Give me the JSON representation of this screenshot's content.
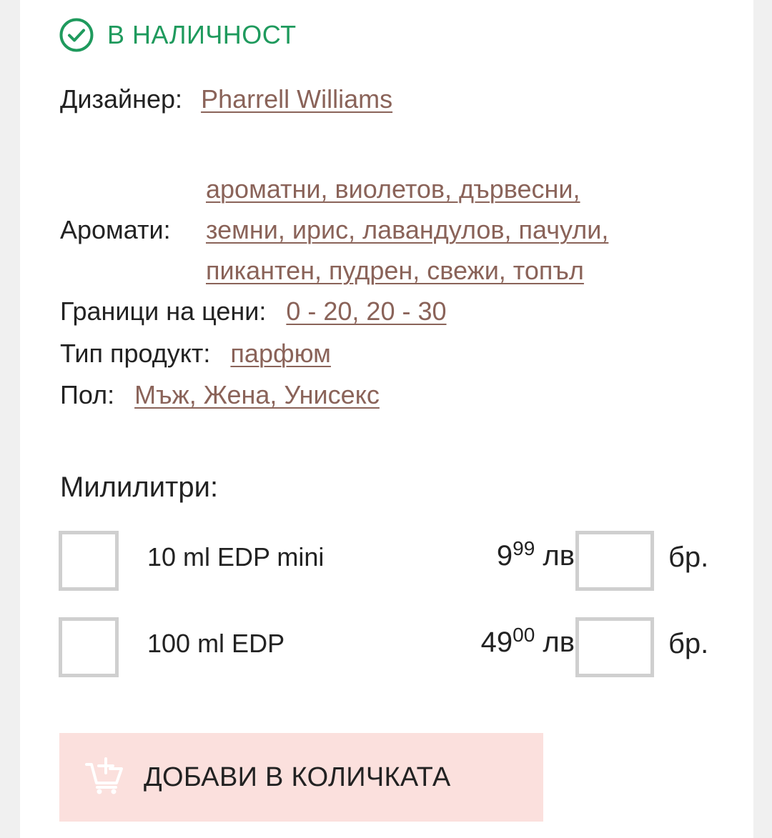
{
  "stock": {
    "status": "В НАЛИЧНОСТ",
    "icon": "check-circle-icon",
    "color": "#1f9a5d"
  },
  "designer": {
    "label": "Дизайнер:",
    "value": "Pharrell Williams"
  },
  "aromas": {
    "label": "Аромати:",
    "lines": [
      "ароматни, виолетов, дървесни,",
      "земни, ирис, лавандулов, пачули,",
      "пикантен, пудрен, свежи, топъл"
    ]
  },
  "price_range": {
    "label": "Граници на цени:",
    "value": "0 - 20, 20 - 30"
  },
  "product_type": {
    "label": "Тип продукт:",
    "value": "парфюм"
  },
  "gender": {
    "label": "Пол:",
    "value": "Мъж, Жена, Унисекс"
  },
  "milliliters": {
    "title": "Милилитри:",
    "variants": [
      {
        "name": "10 ml EDP mini",
        "price_main": "9",
        "price_cents": "99",
        "currency": "лв",
        "quantity": "",
        "unit": "бр."
      },
      {
        "name": "100 ml EDP",
        "price_main": "49",
        "price_cents": "00",
        "currency": "лв",
        "quantity": "",
        "unit": "бр."
      }
    ]
  },
  "cart": {
    "button_label": "ДОБАВИ В КОЛИЧКАТА",
    "icon": "cart-plus-icon",
    "background": "#fbe0dd"
  },
  "colors": {
    "link": "#8a6359",
    "checkbox_border": "#cfcfcf"
  }
}
